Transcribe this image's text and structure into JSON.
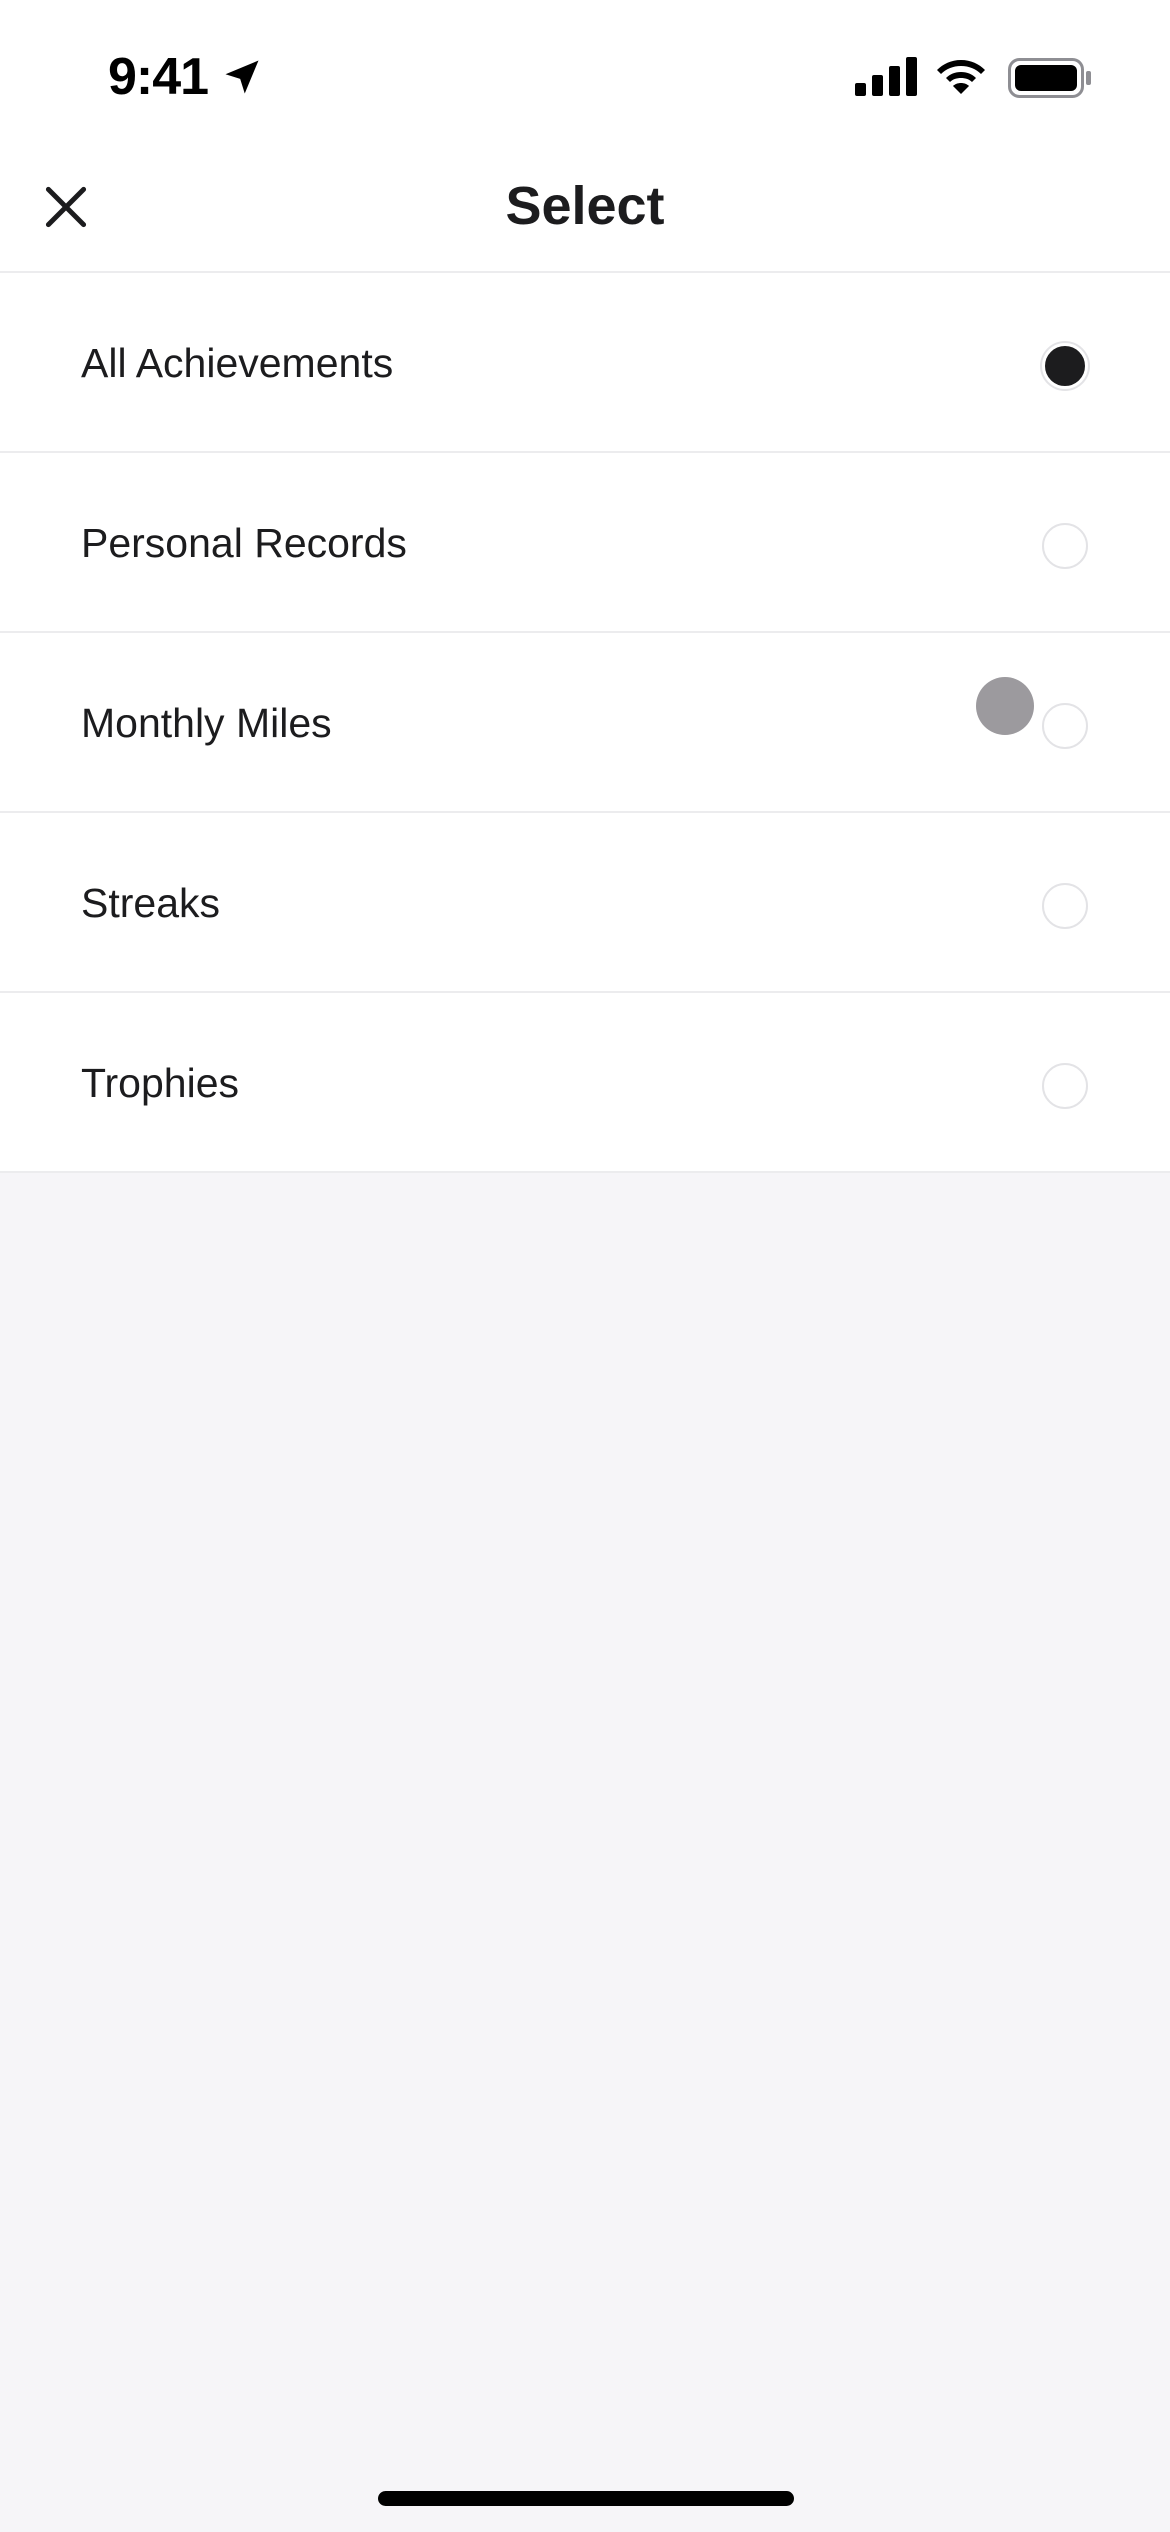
{
  "status_bar": {
    "time": "9:41",
    "icons": [
      "location-arrow-icon",
      "cellular-signal-icon",
      "wifi-icon",
      "battery-icon"
    ]
  },
  "nav": {
    "title": "Select",
    "close_icon": "close-icon"
  },
  "options": [
    {
      "label": "All Achievements",
      "selected": true
    },
    {
      "label": "Personal Records",
      "selected": false
    },
    {
      "label": "Monthly Miles",
      "selected": false
    },
    {
      "label": "Streaks",
      "selected": false
    },
    {
      "label": "Trophies",
      "selected": false
    }
  ],
  "colors": {
    "background": "#f6f5f8",
    "surface": "#ffffff",
    "text": "#1c1c1e",
    "divider": "#ececee",
    "touch_indicator": "#9c9a9e"
  }
}
